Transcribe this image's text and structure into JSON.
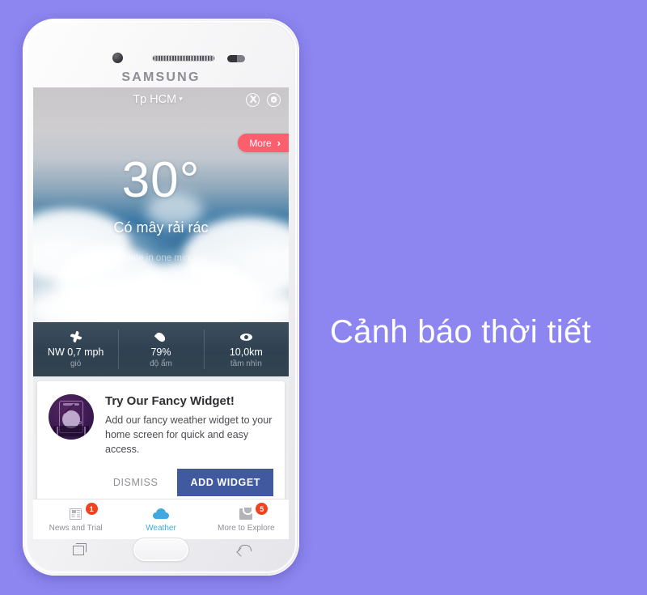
{
  "background_color": "#8d86f0",
  "headline": "Cảnh báo thời tiết",
  "phone": {
    "brand": "SAMSUNG",
    "hardware": {
      "camera": "front-camera",
      "speaker": "earpiece-speaker",
      "sensor": "proximity-sensor",
      "home": "home-button",
      "recents": "recents-button",
      "back": "back-button"
    }
  },
  "app": {
    "appbar": {
      "location": "Tp HCM",
      "caret": "▾",
      "icons": [
        "no-ads-icon",
        "settings-gear-icon"
      ]
    },
    "more_button": {
      "label": "More",
      "chevron": "›",
      "color": "#fb5f6e"
    },
    "current": {
      "temperature": "30°",
      "condition": "Có mây rải rác",
      "update_note": "update in one minutes"
    },
    "stats": [
      {
        "icon": "wind-icon",
        "value": "NW 0,7 mph",
        "label": "gió"
      },
      {
        "icon": "humidity-icon",
        "value": "79%",
        "label": "độ ẩm"
      },
      {
        "icon": "visibility-icon",
        "value": "10,0km",
        "label": "tầm nhìn"
      }
    ],
    "widget_card": {
      "art": "widget-illustration",
      "title": "Try Our Fancy Widget!",
      "body": "Add our fancy weather widget to your home screen for quick and easy access.",
      "dismiss_label": "DISMISS",
      "add_label": "ADD WIDGET",
      "add_color": "#41599f"
    },
    "bottom_nav": [
      {
        "icon": "news-icon",
        "label": "News and Trial",
        "badge": "1",
        "active": false
      },
      {
        "icon": "cloud-icon",
        "label": "Weather",
        "badge": "",
        "active": true
      },
      {
        "icon": "explore-icon",
        "label": "More to Explore",
        "badge": "5",
        "active": false
      }
    ]
  }
}
